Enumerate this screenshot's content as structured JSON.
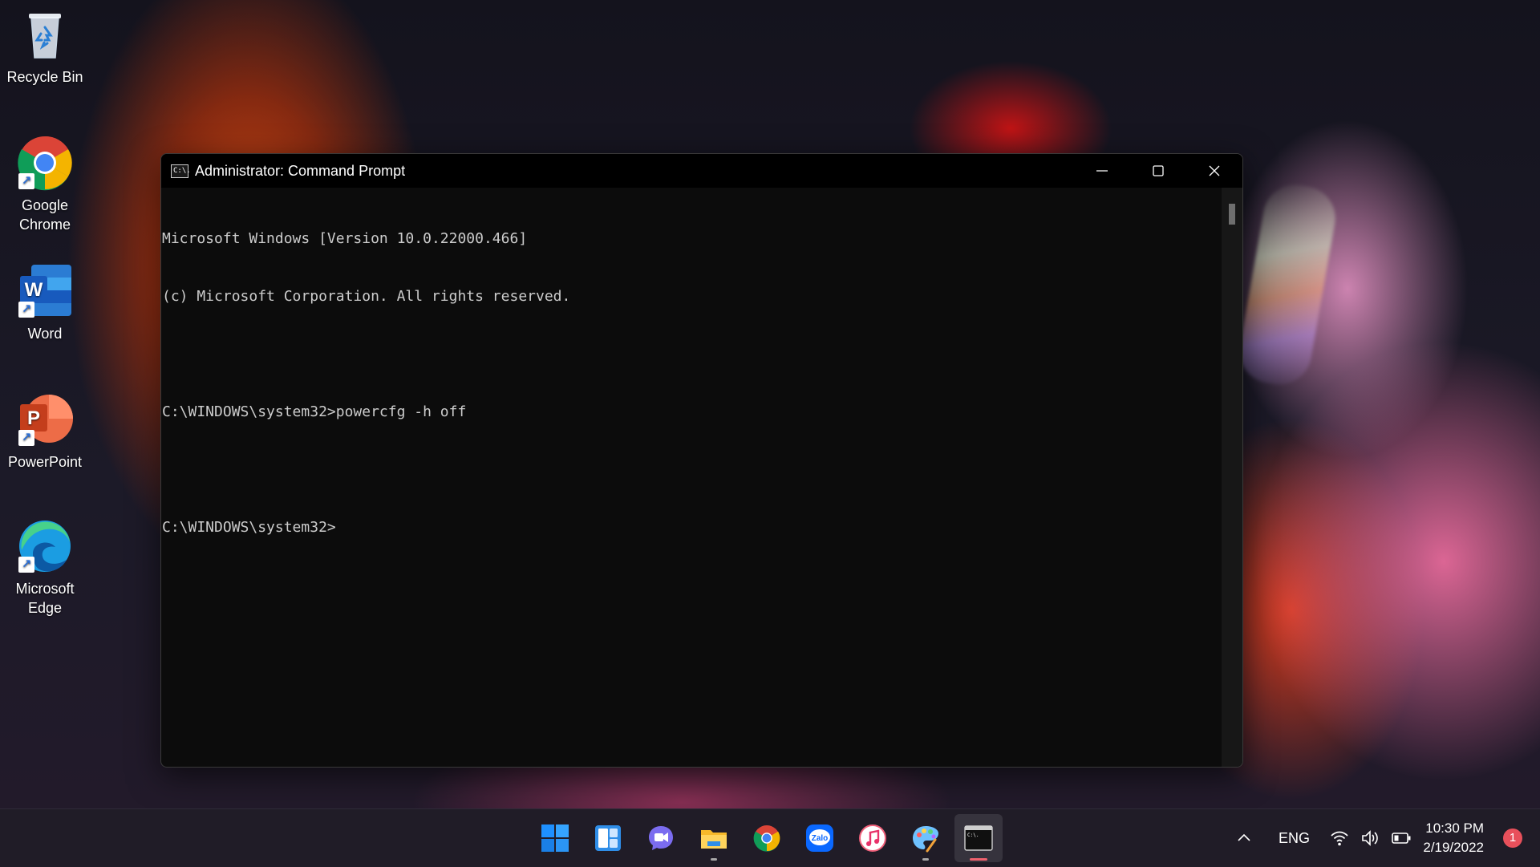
{
  "desktop": {
    "icons": [
      {
        "label": "Recycle Bin"
      },
      {
        "label": "Google\nChrome"
      },
      {
        "label": "Word"
      },
      {
        "label": "PowerPoint"
      },
      {
        "label": "Microsoft\nEdge"
      }
    ]
  },
  "window": {
    "title": "Administrator: Command Prompt",
    "icon_text": "C:\\.",
    "console_lines": [
      "Microsoft Windows [Version 10.0.22000.466]",
      "(c) Microsoft Corporation. All rights reserved.",
      "",
      "C:\\WINDOWS\\system32>powercfg -h off",
      "",
      "C:\\WINDOWS\\system32>"
    ]
  },
  "taskbar": {
    "apps": [
      "start-icon",
      "widgets-icon",
      "chat-icon",
      "file-explorer-icon",
      "chrome-icon",
      "zalo-icon",
      "itunes-icon",
      "paint-icon",
      "command-prompt-icon"
    ],
    "zalo_label": "Zalo",
    "tray": {
      "language": "ENG",
      "time": "10:30 PM",
      "date": "2/19/2022",
      "notification_count": "1"
    }
  },
  "colors": {
    "console_bg": "#0c0c0c",
    "console_text": "#cccccc",
    "active_indicator": "#f0626e",
    "badge": "#e8505b"
  }
}
